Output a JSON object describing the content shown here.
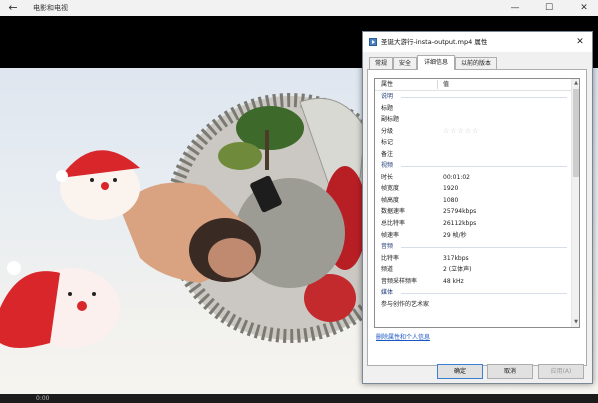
{
  "app": {
    "title": "电影和电视",
    "back_icon": "back-arrow-icon",
    "window_controls": {
      "minimize": "—",
      "maximize": "☐",
      "close": "✕"
    }
  },
  "player": {
    "time_elapsed": "0:00"
  },
  "dialog": {
    "title": "圣诞大游行-insta-output.mp4 属性",
    "close": "✕",
    "tabs": [
      {
        "label": "常规",
        "active": false
      },
      {
        "label": "安全",
        "active": false
      },
      {
        "label": "详细信息",
        "active": true
      },
      {
        "label": "以前的版本",
        "active": false
      }
    ],
    "columns": {
      "property": "属性",
      "value": "值"
    },
    "rows": [
      {
        "type": "section",
        "key": "说明"
      },
      {
        "type": "row",
        "key": "标题",
        "value": ""
      },
      {
        "type": "row",
        "key": "副标题",
        "value": ""
      },
      {
        "type": "rating",
        "key": "分级",
        "stars": "☆☆☆☆☆",
        "rating": 0
      },
      {
        "type": "row",
        "key": "标记",
        "value": ""
      },
      {
        "type": "row",
        "key": "备注",
        "value": ""
      },
      {
        "type": "section",
        "key": "视频"
      },
      {
        "type": "row",
        "key": "时长",
        "value": "00:01:02"
      },
      {
        "type": "row",
        "key": "帧宽度",
        "value": "1920"
      },
      {
        "type": "row",
        "key": "帧高度",
        "value": "1080"
      },
      {
        "type": "row",
        "key": "数据速率",
        "value": "25794kbps"
      },
      {
        "type": "row",
        "key": "总比特率",
        "value": "26112kbps"
      },
      {
        "type": "row",
        "key": "帧速率",
        "value": "29 帧/秒"
      },
      {
        "type": "section",
        "key": "音频"
      },
      {
        "type": "row",
        "key": "比特率",
        "value": "317kbps"
      },
      {
        "type": "row",
        "key": "频道",
        "value": "2 (立体声)"
      },
      {
        "type": "row",
        "key": "音频采样频率",
        "value": "48 kHz"
      },
      {
        "type": "section",
        "key": "媒体"
      },
      {
        "type": "row",
        "key": "参与创作的艺术家",
        "value": ""
      }
    ],
    "remove_link": "删除属性和个人信息",
    "buttons": {
      "ok": "确定",
      "cancel": "取消",
      "apply": "应用(A)"
    }
  },
  "colors": {
    "accent": "#3c7fd0",
    "link": "#1a56c4",
    "section_text": "#1f3d7a",
    "santa_red": "#d8262b"
  }
}
